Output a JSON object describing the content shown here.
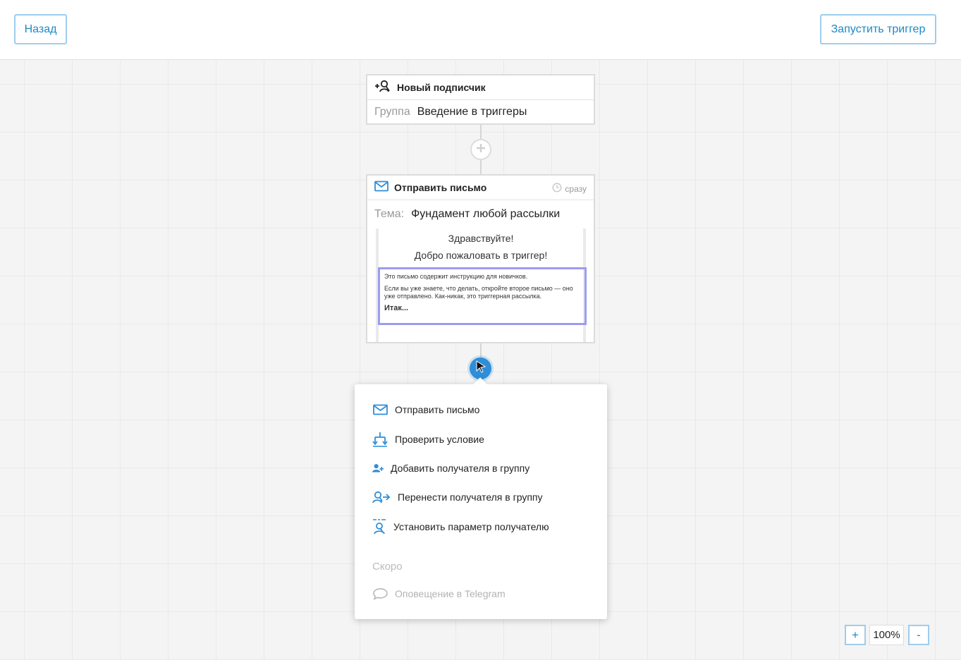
{
  "header": {
    "back_label": "Назад",
    "run_label": "Запустить триггер"
  },
  "node_subscriber": {
    "title": "Новый подписчик",
    "group_label": "Группа",
    "group_value": "Введение в триггеры"
  },
  "node_email": {
    "title": "Отправить письмо",
    "timing": "сразу",
    "subject_label": "Тема:",
    "subject_value": "Фундамент любой рассылки",
    "preview": {
      "greeting": "Здравствуйте!",
      "welcome": "Добро пожаловать в триггер!",
      "line1": "Это письмо содержит инструкцию для новичков.",
      "line2": "Если вы уже знаете, что делать, откройте второе письмо — оно уже отправлено. Как-никак, это триггерная рассылка.",
      "line3": "Итак..."
    }
  },
  "action_menu": {
    "items": [
      {
        "label": "Отправить письмо",
        "icon": "envelope-icon"
      },
      {
        "label": "Проверить условие",
        "icon": "branch-icon"
      },
      {
        "label": "Добавить получателя в группу",
        "icon": "user-plus-icon"
      },
      {
        "label": "Перенести получателя в группу",
        "icon": "user-move-icon"
      },
      {
        "label": "Установить параметр получателю",
        "icon": "user-param-icon"
      }
    ],
    "soon_label": "Скоро",
    "soon_items": [
      {
        "label": "Оповещение в Telegram",
        "icon": "chat-bubble-icon"
      }
    ]
  },
  "zoom": {
    "plus_label": "+",
    "value": "100%",
    "minus_label": "-"
  },
  "colors": {
    "accent": "#1e88c7",
    "button_border": "#9fcdec",
    "highlight_box": "#9c9cf0",
    "cursor_bg": "#2f8ed8"
  }
}
